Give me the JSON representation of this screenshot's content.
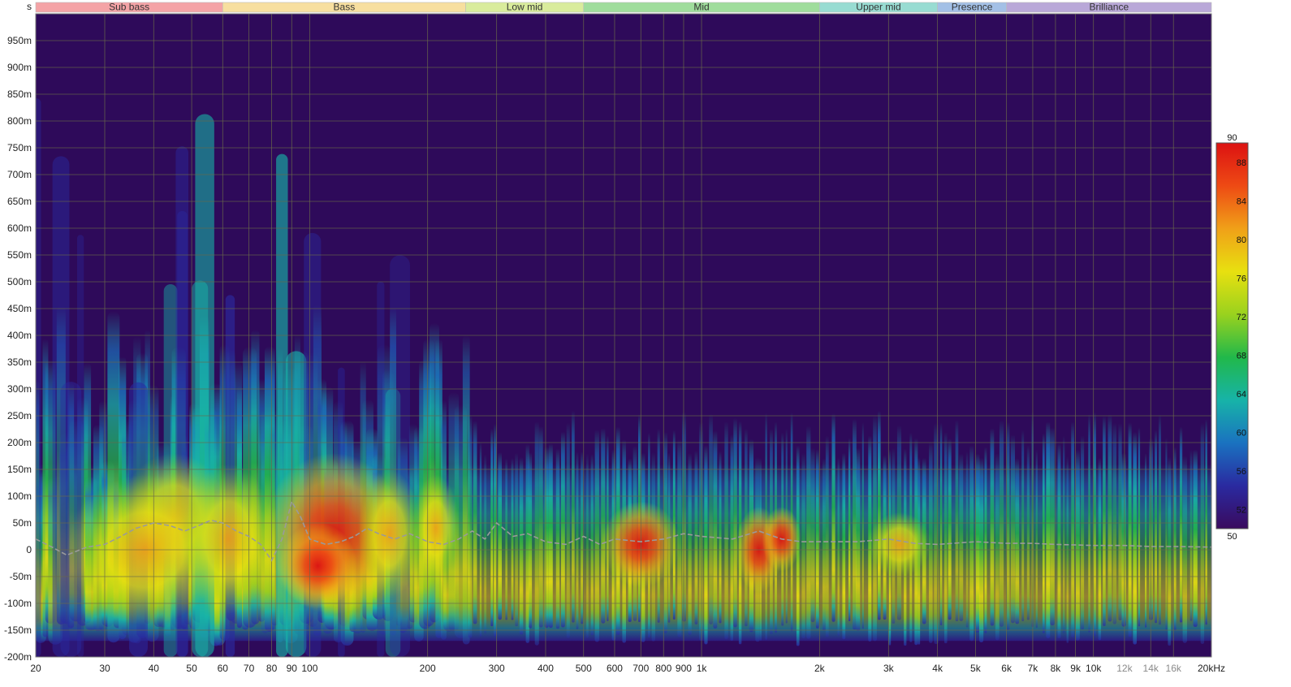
{
  "chart_data": {
    "type": "heatmap",
    "title": "",
    "xlabel": "",
    "ylabel": "s",
    "x_scale": "log",
    "x_unit": "kHz",
    "xlim": [
      20,
      20000
    ],
    "ylim": [
      -0.2,
      1.0
    ],
    "grid": true,
    "x_ticks": [
      {
        "value": 20,
        "label": "20"
      },
      {
        "value": 30,
        "label": "30"
      },
      {
        "value": 40,
        "label": "40"
      },
      {
        "value": 50,
        "label": "50"
      },
      {
        "value": 60,
        "label": "60"
      },
      {
        "value": 70,
        "label": "70"
      },
      {
        "value": 80,
        "label": "80"
      },
      {
        "value": 90,
        "label": "90"
      },
      {
        "value": 100,
        "label": "100"
      },
      {
        "value": 200,
        "label": "200"
      },
      {
        "value": 300,
        "label": "300"
      },
      {
        "value": 400,
        "label": "400"
      },
      {
        "value": 500,
        "label": "500"
      },
      {
        "value": 600,
        "label": "600"
      },
      {
        "value": 700,
        "label": "700"
      },
      {
        "value": 800,
        "label": "800"
      },
      {
        "value": 900,
        "label": "900"
      },
      {
        "value": 1000,
        "label": "1k"
      },
      {
        "value": 2000,
        "label": "2k"
      },
      {
        "value": 3000,
        "label": "3k"
      },
      {
        "value": 4000,
        "label": "4k"
      },
      {
        "value": 5000,
        "label": "5k"
      },
      {
        "value": 6000,
        "label": "6k"
      },
      {
        "value": 7000,
        "label": "7k"
      },
      {
        "value": 8000,
        "label": "8k"
      },
      {
        "value": 9000,
        "label": "9k"
      },
      {
        "value": 10000,
        "label": "10k"
      },
      {
        "value": 12000,
        "label": "12k",
        "dim": true
      },
      {
        "value": 14000,
        "label": "14k",
        "dim": true
      },
      {
        "value": 16000,
        "label": "16k",
        "dim": true
      },
      {
        "value": 20000,
        "label": "20kHz"
      }
    ],
    "y_ticks": [
      {
        "value": 0.95,
        "label": "950m"
      },
      {
        "value": 0.9,
        "label": "900m"
      },
      {
        "value": 0.85,
        "label": "850m"
      },
      {
        "value": 0.8,
        "label": "800m"
      },
      {
        "value": 0.75,
        "label": "750m"
      },
      {
        "value": 0.7,
        "label": "700m"
      },
      {
        "value": 0.65,
        "label": "650m"
      },
      {
        "value": 0.6,
        "label": "600m"
      },
      {
        "value": 0.55,
        "label": "550m"
      },
      {
        "value": 0.5,
        "label": "500m"
      },
      {
        "value": 0.45,
        "label": "450m"
      },
      {
        "value": 0.4,
        "label": "400m"
      },
      {
        "value": 0.35,
        "label": "350m"
      },
      {
        "value": 0.3,
        "label": "300m"
      },
      {
        "value": 0.25,
        "label": "250m"
      },
      {
        "value": 0.2,
        "label": "200m"
      },
      {
        "value": 0.15,
        "label": "150m"
      },
      {
        "value": 0.1,
        "label": "100m"
      },
      {
        "value": 0.05,
        "label": "50m"
      },
      {
        "value": 0.0,
        "label": "0"
      },
      {
        "value": -0.05,
        "label": "-50m"
      },
      {
        "value": -0.1,
        "label": "-100m"
      },
      {
        "value": -0.15,
        "label": "-150m"
      },
      {
        "value": -0.2,
        "label": "-200m"
      }
    ],
    "bands": [
      {
        "label": "Sub bass",
        "from": 20,
        "to": 60,
        "color": "#f4a3a6"
      },
      {
        "label": "Bass",
        "from": 60,
        "to": 250,
        "color": "#f7df9f"
      },
      {
        "label": "Low mid",
        "from": 250,
        "to": 500,
        "color": "#d9ec9c"
      },
      {
        "label": "Mid",
        "from": 500,
        "to": 2000,
        "color": "#9fdd9c"
      },
      {
        "label": "Upper mid",
        "from": 2000,
        "to": 4000,
        "color": "#98dcd2"
      },
      {
        "label": "Presence",
        "from": 4000,
        "to": 6000,
        "color": "#a3c0e6"
      },
      {
        "label": "Brilliance",
        "from": 6000,
        "to": 20000,
        "color": "#b9a8d8"
      }
    ],
    "colorbar": {
      "min": 50,
      "max": 90,
      "labels": [
        90,
        88,
        84,
        80,
        76,
        72,
        68,
        64,
        60,
        56,
        52,
        50
      ],
      "stops": [
        "#3a0a5e",
        "#2a2aa0",
        "#1a72c0",
        "#17b3a8",
        "#21b84a",
        "#9ad21e",
        "#e8e010",
        "#f0a018",
        "#ee4a14",
        "#dc1212"
      ]
    },
    "colors": {
      "background": "#2e0a5a",
      "grid": "#6a6a4a",
      "peak_curve": "#9a9a9a"
    },
    "peak_curve": {
      "name": "",
      "x": [
        20,
        22,
        24,
        27,
        30,
        33,
        36,
        40,
        44,
        48,
        52,
        56,
        60,
        65,
        70,
        75,
        80,
        85,
        90,
        95,
        100,
        110,
        120,
        130,
        140,
        150,
        165,
        180,
        200,
        220,
        240,
        260,
        280,
        300,
        330,
        360,
        400,
        450,
        500,
        550,
        600,
        700,
        800,
        900,
        1000,
        1200,
        1400,
        1600,
        1800,
        2000,
        2500,
        3000,
        3500,
        4000,
        5000,
        6000,
        7000,
        8000,
        10000,
        12000,
        14000,
        16000,
        20000
      ],
      "y": [
        0.02,
        0.005,
        -0.01,
        0.005,
        0.01,
        0.025,
        0.04,
        0.05,
        0.045,
        0.035,
        0.045,
        0.055,
        0.05,
        0.035,
        0.025,
        0.01,
        -0.02,
        0.02,
        0.09,
        0.06,
        0.02,
        0.01,
        0.015,
        0.025,
        0.04,
        0.03,
        0.02,
        0.03,
        0.015,
        0.01,
        0.02,
        0.035,
        0.02,
        0.05,
        0.025,
        0.03,
        0.015,
        0.01,
        0.025,
        0.01,
        0.02,
        0.015,
        0.02,
        0.03,
        0.025,
        0.02,
        0.035,
        0.02,
        0.015,
        0.015,
        0.015,
        0.02,
        0.012,
        0.01,
        0.015,
        0.012,
        0.012,
        0.01,
        0.008,
        0.008,
        0.006,
        0.006,
        0.005
      ]
    },
    "hotspots": [
      {
        "f": 115,
        "t": 0.03,
        "level": 90,
        "w": 0.18,
        "h": 0.15
      },
      {
        "f": 105,
        "t": -0.03,
        "level": 88,
        "w": 0.1,
        "h": 0.08
      },
      {
        "f": 45,
        "t": 0.06,
        "level": 82,
        "w": 0.14,
        "h": 0.12
      },
      {
        "f": 38,
        "t": 0.0,
        "level": 76,
        "w": 0.2,
        "h": 0.14
      },
      {
        "f": 62,
        "t": 0.02,
        "level": 78,
        "w": 0.12,
        "h": 0.14
      },
      {
        "f": 160,
        "t": 0.03,
        "level": 82,
        "w": 0.08,
        "h": 0.12
      },
      {
        "f": 210,
        "t": 0.04,
        "level": 80,
        "w": 0.06,
        "h": 0.1
      },
      {
        "f": 700,
        "t": 0.01,
        "level": 84,
        "w": 0.1,
        "h": 0.08
      },
      {
        "f": 1400,
        "t": 0.0,
        "level": 87,
        "w": 0.06,
        "h": 0.08
      },
      {
        "f": 1600,
        "t": 0.02,
        "level": 85,
        "w": 0.05,
        "h": 0.06
      },
      {
        "f": 3200,
        "t": 0.01,
        "level": 82,
        "w": 0.08,
        "h": 0.06
      }
    ]
  }
}
